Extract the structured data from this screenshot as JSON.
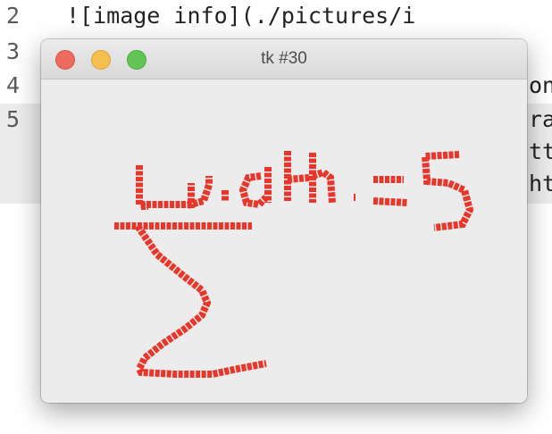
{
  "editor": {
    "lines": [
      {
        "number": "2",
        "text": "![image info](./pictures/i"
      },
      {
        "number": "3",
        "text": ""
      },
      {
        "number": "4",
        "text": "on"
      },
      {
        "number": "5",
        "text": "ra"
      },
      {
        "number": "",
        "text": "tt"
      },
      {
        "number": "",
        "text": "ht"
      }
    ]
  },
  "window": {
    "title": "tk #30",
    "controls": [
      "close",
      "minimize",
      "maximize"
    ]
  },
  "canvas": {
    "ink_color": "#e8372a",
    "background": "#ececec",
    "drawing": "handwritten-sum-formula"
  }
}
